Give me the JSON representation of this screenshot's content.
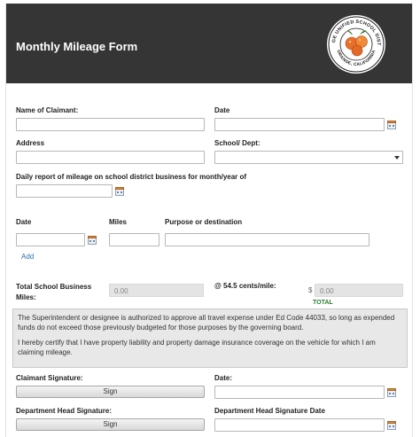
{
  "header": {
    "title": "Monthly Mileage Form"
  },
  "logo": {
    "name": "orange-unified-school-district-seal",
    "text_top": "ORANGE UNIFIED SCHOOL DISTRICT",
    "text_bottom": "ORANGE, CALIFORNIA"
  },
  "fields": {
    "claimant_name_label": "Name of Claimant:",
    "date_label": "Date",
    "address_label": "Address",
    "school_dept_label": "School/ Dept:",
    "daily_report_label": "Daily report of mileage on school district business for month/year of"
  },
  "entries": {
    "date_header": "Date",
    "miles_header": "Miles",
    "purpose_header": "Purpose or destination",
    "add_link": "Add"
  },
  "totals": {
    "total_miles_label": "Total School Business Miles:",
    "total_miles_value": "0.00",
    "rate_label": "@ 54.5 cents/mile:",
    "dollar_sign": "$",
    "total_value": "0.00",
    "total_caption": "TOTAL"
  },
  "notice": {
    "paragraph1": "The Superintendent or designee is authorized to approve all travel expense under Ed Code 44033, so long as expended funds do not exceed those previously budgeted for those purposes by the governing board.",
    "paragraph2": "I hereby certify that I have property liability and property damage insurance coverage on the vehicle for which I am claiming mileage."
  },
  "signatures": {
    "claimant_label": "Claimant Signature:",
    "claimant_date_label": "Date:",
    "dept_head_label": "Department Head Signature:",
    "dept_head_date_label": "Department Head Signature Date",
    "sign_button": "Sign"
  },
  "colors": {
    "header_bg": "#353535",
    "link": "#2a6fb5",
    "total_caption": "#2e7d32"
  },
  "icons": [
    "calendar-icon",
    "chevron-down-icon"
  ]
}
